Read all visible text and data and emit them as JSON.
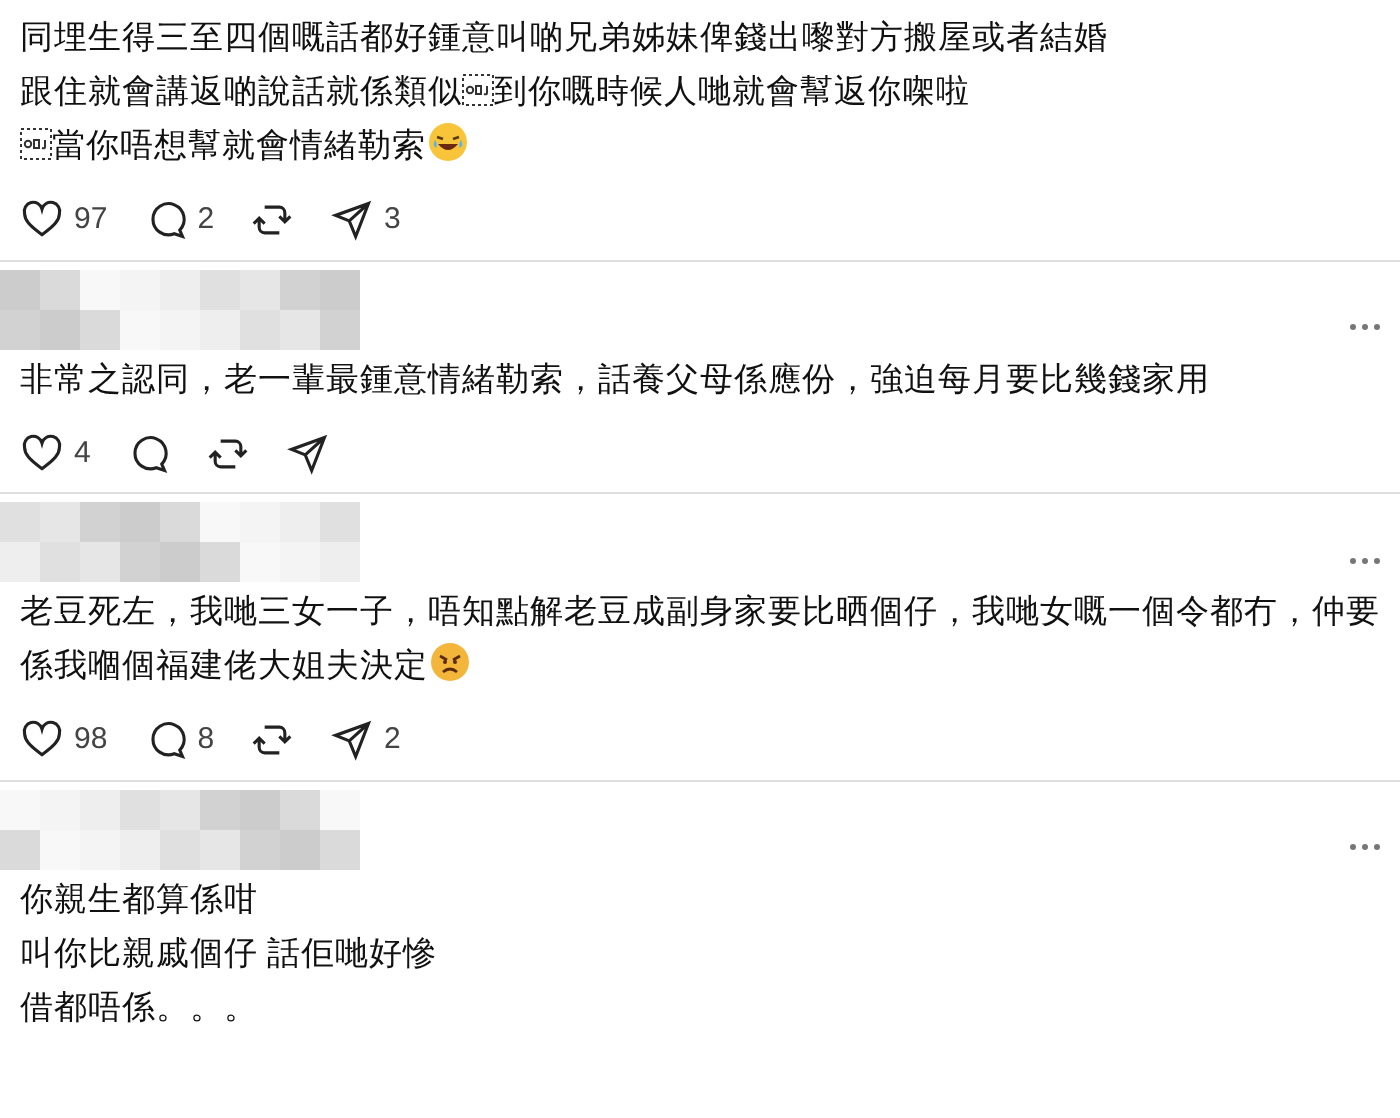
{
  "comments": [
    {
      "lines": [
        [
          {
            "text": "同埋生得三至四個嘅話都好鍾意叫啲兄弟姊妹俾錢出嚟對方搬屋或者結婚"
          }
        ],
        [
          {
            "text": "跟住就會講返啲說話就係類似"
          },
          {
            "kind": "object"
          },
          {
            "text": "到你嘅時候人哋就會幫返你㗎啦"
          }
        ],
        [
          {
            "kind": "object"
          },
          {
            "text": "當你唔想幫就會情緒勒索"
          },
          {
            "kind": "laughing-face"
          }
        ]
      ],
      "actions": {
        "likes": "97",
        "replies": "2",
        "shares": "3"
      }
    },
    {
      "blurred_author": true,
      "more_menu": true,
      "lines": [
        [
          {
            "text": "非常之認同，老一輩最鍾意情緒勒索，話養父母係應份，強迫每月要比幾錢家用"
          }
        ]
      ],
      "actions": {
        "likes": "4"
      }
    },
    {
      "blurred_author": true,
      "more_menu": true,
      "lines": [
        [
          {
            "text": "老豆死左，我哋三女一子，唔知點解老豆成副身家要比晒個仔，我哋女嘅一個令都冇，仲要係我嗰個福建佬大姐夫決定"
          },
          {
            "kind": "angry-face"
          }
        ]
      ],
      "actions": {
        "likes": "98",
        "replies": "8",
        "shares": "2"
      }
    },
    {
      "blurred_author": true,
      "more_menu": true,
      "lines": [
        [
          {
            "text": "你親生都算係咁"
          }
        ],
        [
          {
            "text": "叫你比親戚個仔 話佢哋好慘"
          }
        ],
        [
          {
            "text": "借都唔係。。。"
          }
        ]
      ]
    }
  ]
}
